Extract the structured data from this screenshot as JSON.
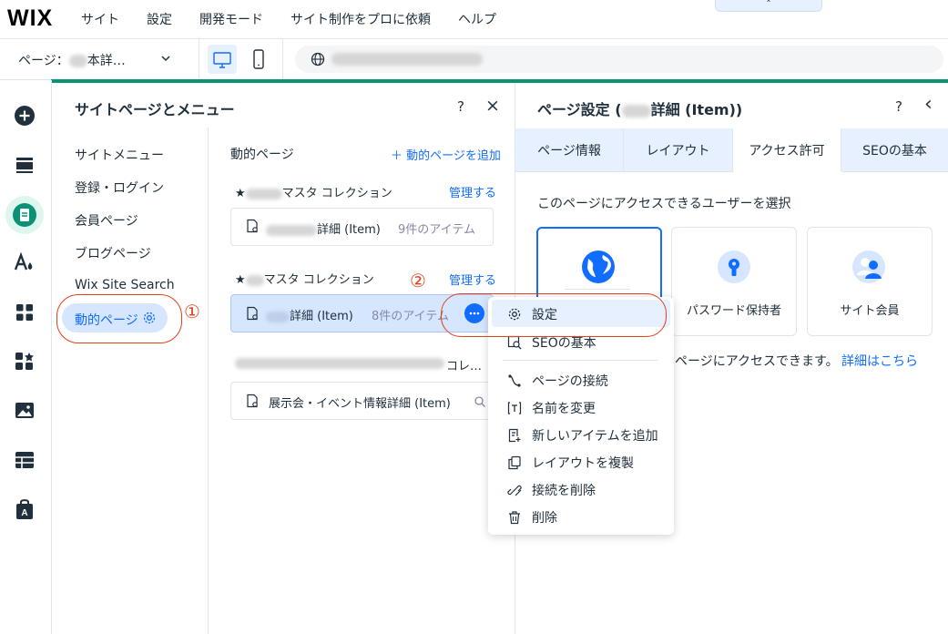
{
  "topbar": {
    "logo": "WIX",
    "menu": [
      "サイト",
      "設定",
      "開発モード",
      "サイト制作をプロに依頼",
      "ヘルプ"
    ],
    "collapse": "˄"
  },
  "page_selector": {
    "prefix": "ページ：",
    "value": "本詳…"
  },
  "sites_panel": {
    "title": "サイトページとメニュー",
    "help": "?",
    "close": "×",
    "nav": [
      "サイトメニュー",
      "登録・ログイン",
      "会員ページ",
      "ブログページ",
      "Wix Site Search",
      "動的ページ"
    ],
    "section_title": "動的ページ",
    "add_link": "＋ 動的ページを追加",
    "collections": [
      {
        "name": "マスタ コレクション",
        "manage": "管理する",
        "item": "詳細 (Item)",
        "count": "9件のアイテム"
      },
      {
        "name": "マスタ コレクション",
        "manage": "管理する",
        "item": "詳細 (Item)",
        "count": "8件のアイテム"
      },
      {
        "name": "コレ…",
        "item": "展示会・イベント情報詳細 (Item)"
      }
    ],
    "star": "★"
  },
  "annotations": {
    "one": "①",
    "two": "②"
  },
  "settings_panel": {
    "title_prefix": "ページ設定 (",
    "title_suffix": "詳細 (Item))",
    "help": "?",
    "back": "‹",
    "tabs": [
      "ページ情報",
      "レイアウト",
      "アクセス許可",
      "SEOの基本"
    ],
    "access_heading": "このページにアクセスできるユーザーを選択",
    "access_options": [
      "",
      "パスワード保持者",
      "サイト会員"
    ],
    "info_text": "ページにアクセスできます。",
    "info_link": "詳細はこちら"
  },
  "context_menu": {
    "items": [
      "設定",
      "SEOの基本",
      "ページの接続",
      "名前を変更",
      "新しいアイテムを追加",
      "レイアウトを複製",
      "接続を削除",
      "削除"
    ]
  },
  "colors": {
    "accent": "#116dff",
    "green": "#0b9176",
    "annotation": "#e0401c"
  }
}
